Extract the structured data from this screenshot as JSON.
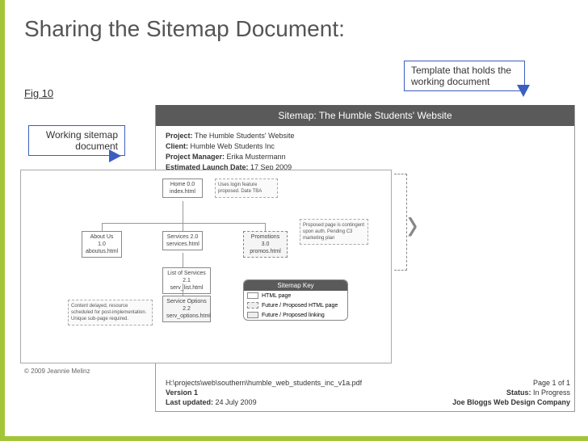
{
  "title": "Sharing the Sitemap Document:",
  "fig": "Fig 10",
  "callout_template": "Template that holds the working document",
  "callout_working": "Working sitemap document",
  "template_title": "Sitemap: The Humble Students' Website",
  "meta": {
    "project_label": "Project:",
    "project": "The Humble Students' Website",
    "client_label": "Client:",
    "client": "Humble Web Students Inc",
    "pm_label": "Project Manager:",
    "pm": "Erika Mustermann",
    "launch_label": "Estimated Launch Date:",
    "launch": "17 Sep 2009"
  },
  "footer": {
    "path": "H:\\projects\\web\\southern\\humble_web_students_inc_v1a.pdf",
    "version_label": "Version 1",
    "updated_label": "Last updated:",
    "updated": "24 July 2009",
    "page": "Page 1 of 1",
    "status_label": "Status:",
    "status": "In Progress",
    "company": "Joe Bloggs Web Design Company"
  },
  "copyright": "© 2009 Jeannie Melinz",
  "nodes": {
    "home": "Home\n0.0\nindex.html",
    "about": "About Us\n1.0\naboutus.html",
    "services": "Services\n2.0\nservices.html",
    "promo": "Promotions\n3.0\npromos.html",
    "list": "List of Services\n2.1\nserv_list.html",
    "opts": "Service Options\n2.2\nserv_options.html"
  },
  "notes": {
    "n1": "Uses login feature proposed. Date TBA",
    "n2": "Proposed page is contingent upon auth. Pending C3 marketing plan",
    "n3": "Content delayed, resource scheduled for post-implementation. Unique sub-page required."
  },
  "key": {
    "title": "Sitemap Key",
    "r1": "HTML page",
    "r2": "Future / Proposed HTML page",
    "r3": "Future / Proposed linking"
  }
}
